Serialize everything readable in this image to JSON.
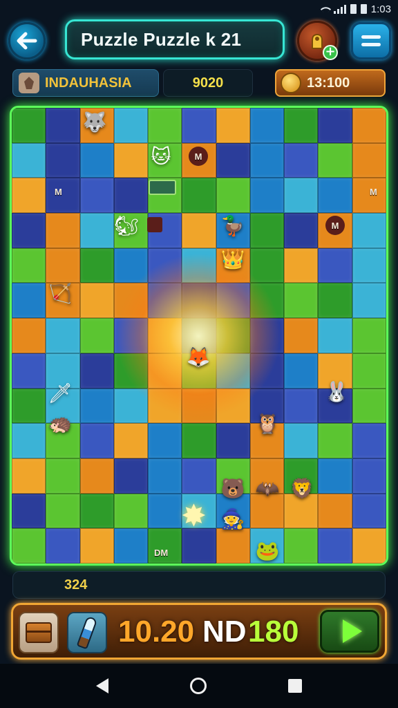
{
  "status_bar": {
    "time": "1:03"
  },
  "header": {
    "title": "Puzzle Puzzle k 21"
  },
  "info": {
    "player_name": "INDAUHASIA",
    "score": "9020",
    "timer": "13:100"
  },
  "board": {
    "markers": [
      "M",
      "M",
      "M",
      "M",
      "DM"
    ]
  },
  "bottom": {
    "counter": "324",
    "value_1": "10.20",
    "value_2": "ND",
    "value_3": "180"
  },
  "colors": {
    "board_border": "#5dff5a",
    "title_border": "#37e6d4",
    "action_border": "#f1a634",
    "play_accent": "#7dff3a"
  },
  "icons": {
    "back": "arrow-left-icon",
    "shop": "shop-icon",
    "menu": "menu-icon",
    "play": "play-icon"
  }
}
